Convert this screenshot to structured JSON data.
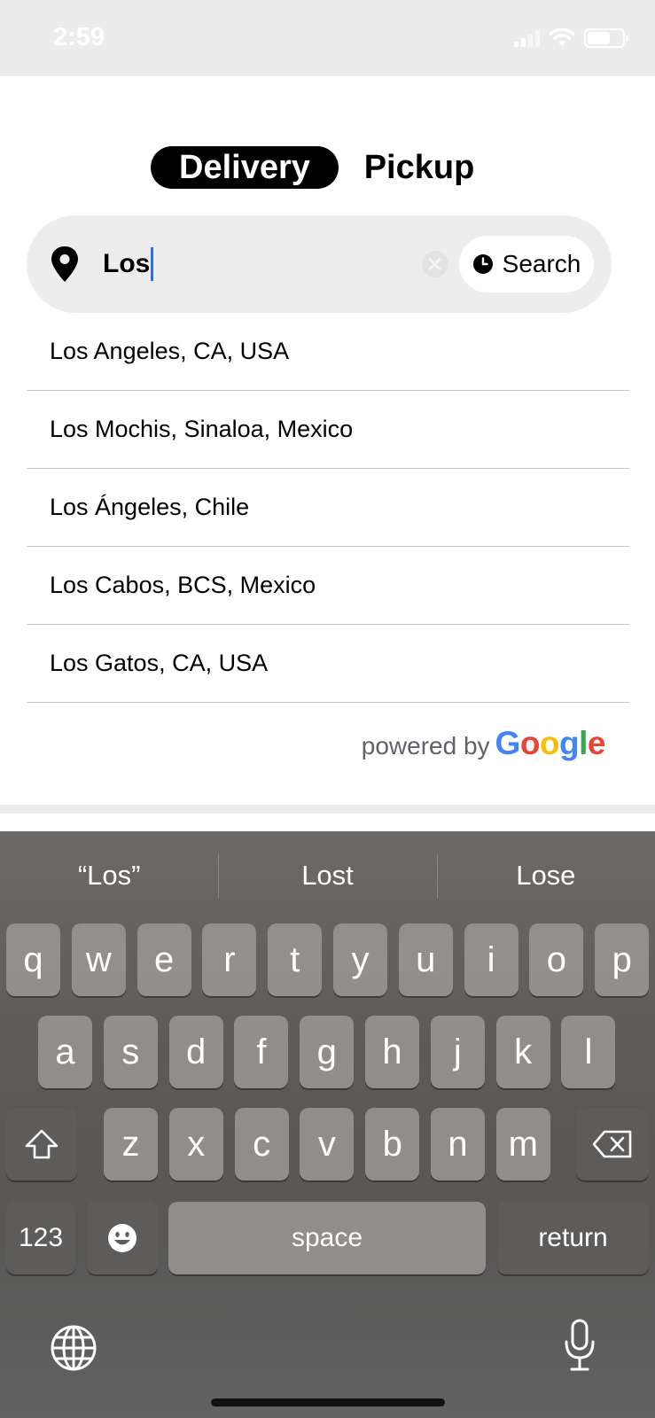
{
  "status_bar": {
    "time": "2:59"
  },
  "tabs": {
    "delivery": "Delivery",
    "pickup": "Pickup",
    "active": "Delivery"
  },
  "search": {
    "value": "Los",
    "button_label": "Search"
  },
  "suggestions": [
    "Los Angeles, CA, USA",
    "Los Mochis, Sinaloa, Mexico",
    "Los Ángeles, Chile",
    "Los Cabos, BCS, Mexico",
    "Los Gatos, CA, USA"
  ],
  "attribution": {
    "prefix": "powered by",
    "brand": "Google",
    "brand_colors": [
      "#4285F4",
      "#EA4335",
      "#FBBC05",
      "#4285F4",
      "#34A853",
      "#EA4335"
    ]
  },
  "keyboard": {
    "predictions": [
      "“Los”",
      "Lost",
      "Lose"
    ],
    "row1": [
      "q",
      "w",
      "e",
      "r",
      "t",
      "y",
      "u",
      "i",
      "o",
      "p"
    ],
    "row2": [
      "a",
      "s",
      "d",
      "f",
      "g",
      "h",
      "j",
      "k",
      "l"
    ],
    "row3": [
      "z",
      "x",
      "c",
      "v",
      "b",
      "n",
      "m"
    ],
    "numbers_label": "123",
    "space_label": "space",
    "return_label": "return"
  },
  "icons": {
    "location": "map-pin-icon",
    "clear": "clear-icon",
    "search": "clock-icon",
    "shift": "shift-icon",
    "delete": "backspace-icon",
    "emoji": "emoji-icon",
    "globe": "globe-icon",
    "mic": "microphone-icon"
  }
}
